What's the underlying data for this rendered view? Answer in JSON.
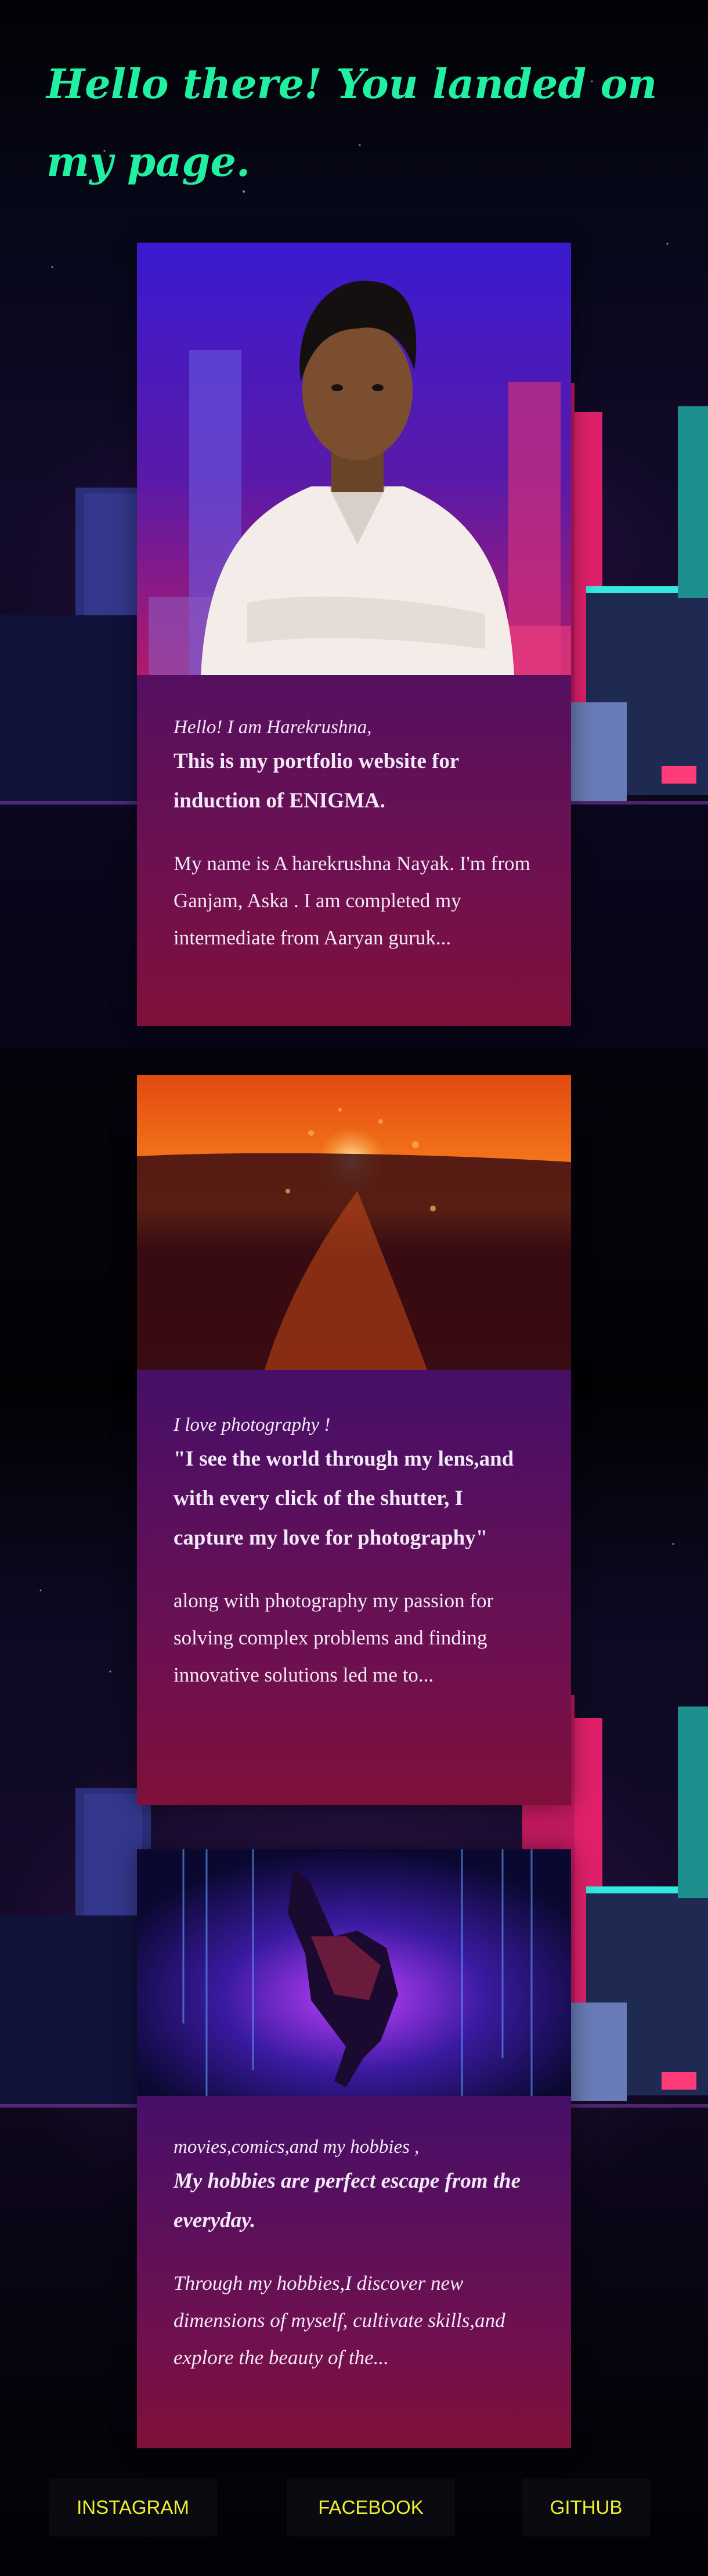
{
  "header": {
    "title": "Hello there! You landed on my page."
  },
  "cards": [
    {
      "image": "portrait-photo",
      "lead": "Hello! I am Harekrushna,",
      "headline": "This is my portfolio website for induction of ENIGMA.",
      "body": "My name is A harekrushna Nayak. I'm from Ganjam, Aska . I am completed my intermediate from Aaryan guruk..."
    },
    {
      "image": "sunset-splash-photo",
      "lead": "I love photography !",
      "headline": "\"I see the world through my lens,and with every click of the shutter, I capture my love for photography\"",
      "body": "along with photography my passion for solving complex problems and finding innovative solutions led me to..."
    },
    {
      "image": "spider-verse-artwork",
      "lead": "movies,comics,and my hobbies ,",
      "headline": "My hobbies are perfect escape from the everyday.",
      "body": "Through my hobbies,I discover new dimensions of myself, cultivate skills,and explore the beauty of the..."
    }
  ],
  "footer": {
    "links": [
      "INSTAGRAM",
      "FACEBOOK",
      "GITHUB"
    ]
  },
  "colors": {
    "title": "#21f0a0",
    "link": "#eef034",
    "card_top": "#2c0e6e",
    "card_bottom": "#80103a"
  }
}
